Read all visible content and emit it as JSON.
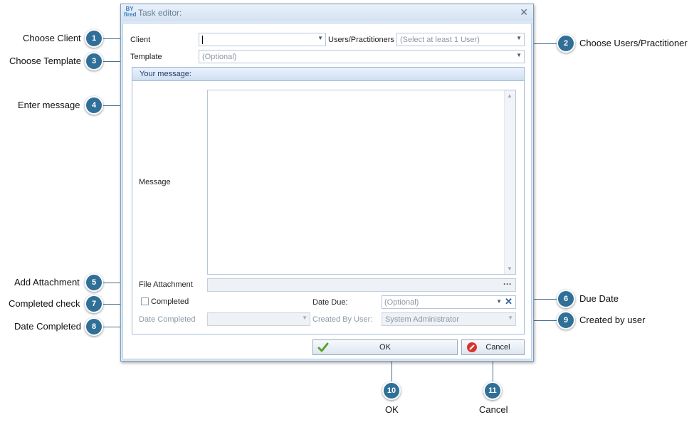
{
  "callouts": [
    {
      "num": "1",
      "label": "Choose Client"
    },
    {
      "num": "2",
      "label": "Choose Users/Practitioner"
    },
    {
      "num": "3",
      "label": "Choose Template"
    },
    {
      "num": "4",
      "label": "Enter message"
    },
    {
      "num": "5",
      "label": "Add Attachment"
    },
    {
      "num": "6",
      "label": "Due Date"
    },
    {
      "num": "7",
      "label": "Completed check"
    },
    {
      "num": "8",
      "label": "Date Completed"
    },
    {
      "num": "9",
      "label": "Created by user"
    },
    {
      "num": "10",
      "label": "OK"
    },
    {
      "num": "11",
      "label": "Cancel"
    }
  ],
  "dialog": {
    "title": "Task editor:",
    "app_icon_text": "BY fired",
    "close_glyph": "✕"
  },
  "form": {
    "client_label": "Client",
    "client_value": "",
    "users_label": "Users/Practitioners",
    "users_placeholder": "(Select at least 1 User)",
    "template_label": "Template",
    "template_placeholder": "(Optional)",
    "group_title": "Your message:",
    "message_label": "Message",
    "message_value": "",
    "attachment_label": "File Attachment",
    "attachment_button": "···",
    "completed_label": "Completed",
    "completed_checked": false,
    "date_due_label": "Date Due:",
    "date_due_placeholder": "(Optional)",
    "date_completed_label": "Date Completed",
    "date_completed_value": "",
    "created_by_label": "Created By User:",
    "created_by_value": "System Administrator"
  },
  "buttons": {
    "ok_label": "OK",
    "cancel_label": "Cancel"
  },
  "colors": {
    "accent": "#2f6f98",
    "dialog_frame": "#dde9f6",
    "ok_check": "#5aa02c",
    "cancel_icon": "#d9342b"
  },
  "icons": {
    "dropdown": "chevron-down-icon",
    "close": "close-icon",
    "ok": "check-icon",
    "cancel": "cancel-icon"
  }
}
